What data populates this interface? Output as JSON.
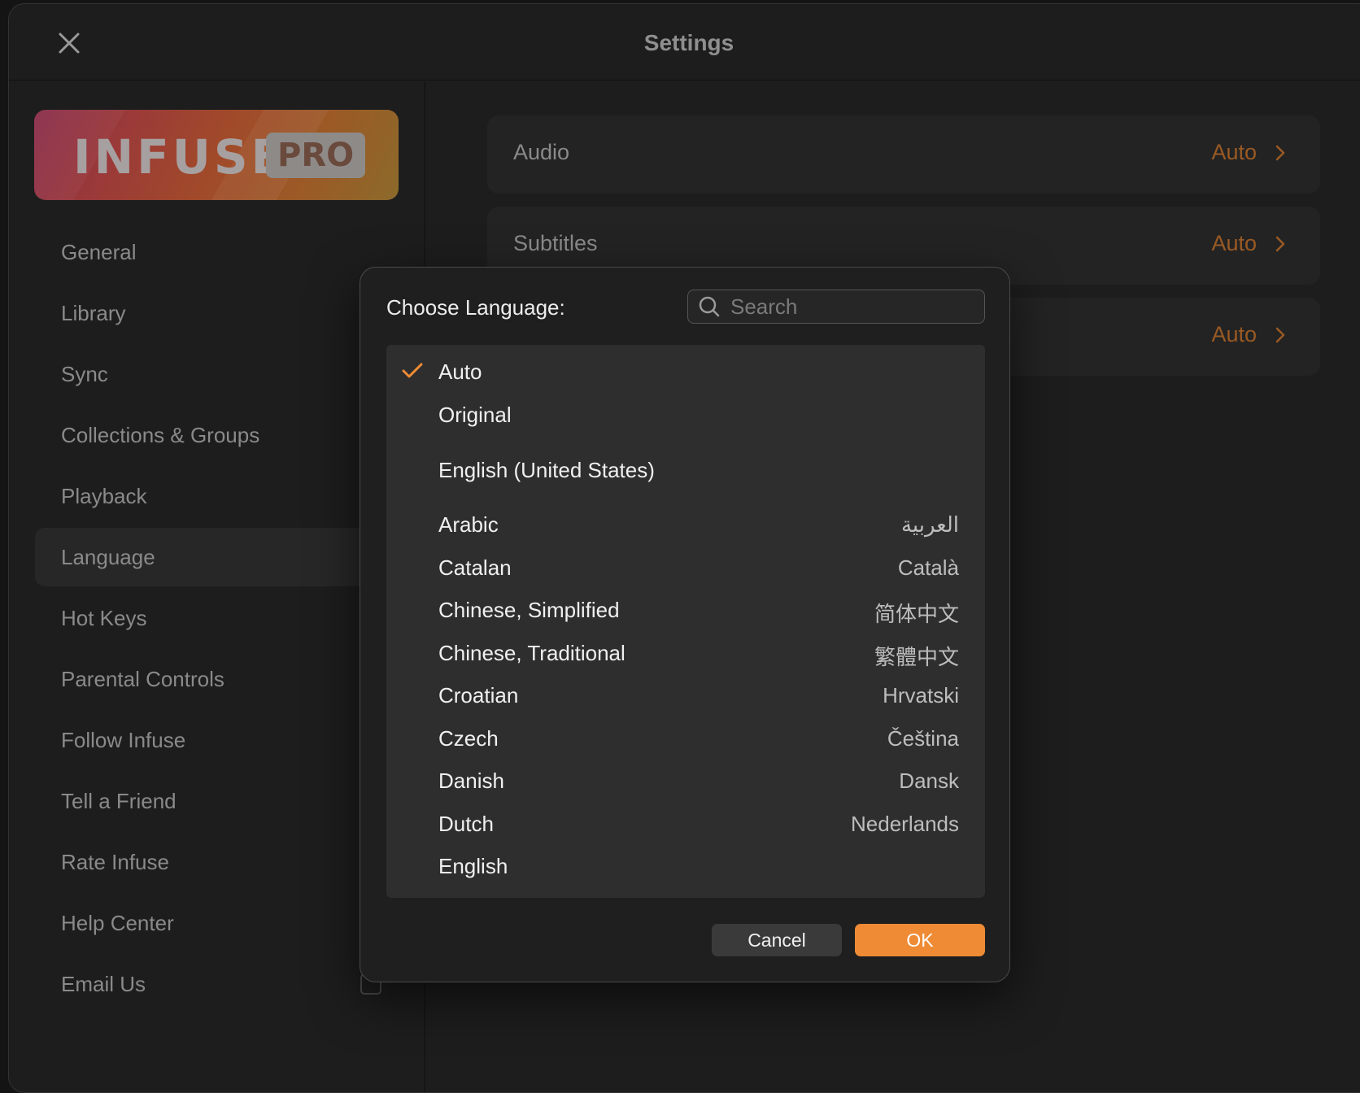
{
  "window": {
    "title": "Settings"
  },
  "sidebar": {
    "logo": {
      "text": "INFUSE",
      "badge": "PRO"
    },
    "items": [
      {
        "label": "General",
        "selected": false,
        "external": false
      },
      {
        "label": "Library",
        "selected": false,
        "external": false
      },
      {
        "label": "Sync",
        "selected": false,
        "external": false
      },
      {
        "label": "Collections & Groups",
        "selected": false,
        "external": false
      },
      {
        "label": "Playback",
        "selected": false,
        "external": false
      },
      {
        "label": "Language",
        "selected": true,
        "external": false
      },
      {
        "label": "Hot Keys",
        "selected": false,
        "external": false
      },
      {
        "label": "Parental Controls",
        "selected": false,
        "external": false
      },
      {
        "label": "Follow Infuse",
        "selected": false,
        "external": true
      },
      {
        "label": "Tell a Friend",
        "selected": false,
        "external": true
      },
      {
        "label": "Rate Infuse",
        "selected": false,
        "external": true
      },
      {
        "label": "Help Center",
        "selected": false,
        "external": true
      },
      {
        "label": "Email Us",
        "selected": false,
        "external": true
      }
    ]
  },
  "content": {
    "rows": [
      {
        "label": "Audio",
        "value": "Auto"
      },
      {
        "label": "Subtitles",
        "value": "Auto"
      },
      {
        "label": "",
        "value": "Auto"
      }
    ]
  },
  "dialog": {
    "title": "Choose Language:",
    "search_placeholder": "Search",
    "selected": "Auto",
    "items": [
      {
        "name": "Auto",
        "native": "",
        "checked": true
      },
      {
        "name": "Original",
        "native": "",
        "checked": false
      },
      {
        "name": "English (United States)",
        "native": "",
        "checked": false
      },
      {
        "name": "Arabic",
        "native": "العربية",
        "checked": false
      },
      {
        "name": "Catalan",
        "native": "Català",
        "checked": false
      },
      {
        "name": "Chinese, Simplified",
        "native": "简体中文",
        "checked": false
      },
      {
        "name": "Chinese, Traditional",
        "native": "繁體中文",
        "checked": false
      },
      {
        "name": "Croatian",
        "native": "Hrvatski",
        "checked": false
      },
      {
        "name": "Czech",
        "native": "Čeština",
        "checked": false
      },
      {
        "name": "Danish",
        "native": "Dansk",
        "checked": false
      },
      {
        "name": "Dutch",
        "native": "Nederlands",
        "checked": false
      },
      {
        "name": "English",
        "native": "",
        "checked": false
      }
    ],
    "cancel_label": "Cancel",
    "ok_label": "OK"
  },
  "colors": {
    "accent": "#ef8b35",
    "value_dim": "#9a5a24",
    "background": "#1d1d1d"
  }
}
